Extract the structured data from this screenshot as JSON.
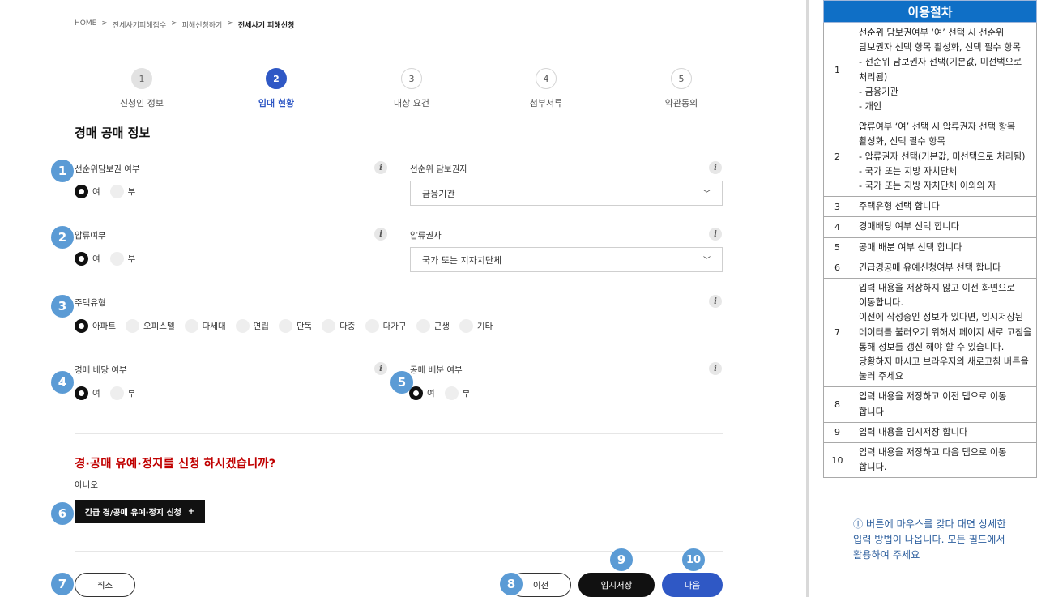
{
  "breadcrumb": [
    "HOME",
    "전세사기피해접수",
    "피해신청하기",
    "전세사기 피해신청"
  ],
  "breadcrumb_separator": ">",
  "steps": [
    {
      "num": "1",
      "label": "신청인 정보",
      "state": "done"
    },
    {
      "num": "2",
      "label": "임대 현황",
      "state": "active"
    },
    {
      "num": "3",
      "label": "대상 요건",
      "state": "todo"
    },
    {
      "num": "4",
      "label": "첨부서류",
      "state": "todo"
    },
    {
      "num": "5",
      "label": "약관동의",
      "state": "todo"
    }
  ],
  "section_title": "경매 공매 정보",
  "info_icon": "i",
  "fields": {
    "senior_collateral": {
      "label": "선순위담보권 여부",
      "options": [
        "여",
        "부"
      ],
      "selected": "여"
    },
    "senior_creditor": {
      "label": "선순위 담보권자",
      "value": "금융기관"
    },
    "seizure": {
      "label": "압류여부",
      "options": [
        "여",
        "부"
      ],
      "selected": "여"
    },
    "seizure_holder": {
      "label": "압류권자",
      "value": "국가 또는 지자치단체"
    },
    "housing_type": {
      "label": "주택유형",
      "options": [
        "아파트",
        "오피스텔",
        "다세대",
        "연립",
        "단독",
        "다중",
        "다가구",
        "근생",
        "기타"
      ],
      "selected": "아파트"
    },
    "auction_dividend": {
      "label": "경매 배당 여부",
      "options": [
        "여",
        "부"
      ],
      "selected": "여"
    },
    "public_dividend": {
      "label": "공매 배분 여부",
      "options": [
        "여",
        "부"
      ],
      "selected": "여"
    }
  },
  "question": "경·공매 유예·정지를 신청 하시겠습니까?",
  "answer": "아니오",
  "urgent_button": {
    "label": "긴급 경/공매 유예·정지 신청",
    "icon": "+"
  },
  "buttons": {
    "cancel": "취소",
    "prev": "이전",
    "temp_save": "임시저장",
    "next": "다음"
  },
  "badges": [
    "1",
    "2",
    "3",
    "4",
    "5",
    "6",
    "7",
    "8",
    "9",
    "10"
  ],
  "colors": {
    "accent": "#2f58c5",
    "badge": "#5b9bd5",
    "question": "#c00000",
    "panel_header": "#0f6fc6",
    "note": "#2d5f9e"
  },
  "panel": {
    "title": "이용절차",
    "rows": [
      {
        "num": "1",
        "text": "선순위 담보권여부 ‘여’ 선택 시 선순위 담보권자 선택 항목 활성화, 선택 필수 항목\n- 선순위 담보권자 선택(기본값, 미선택으로 처리됨)\n- 금융기관\n- 개인"
      },
      {
        "num": "2",
        "text": "압류여부 ‘여’ 선택 시 압류권자 선택 항목 활성화, 선택 필수 항목\n- 압류권자 선택(기본값, 미선택으로 처리됨)\n- 국가 또는 지방 자치단체\n- 국가 또는 지방 자치단체 이외의 자"
      },
      {
        "num": "3",
        "text": "주택유형 선택 합니다"
      },
      {
        "num": "4",
        "text": "경매배당 여부 선택 합니다"
      },
      {
        "num": "5",
        "text": "공매 배분 여부 선택 합니다"
      },
      {
        "num": "6",
        "text": "긴급경공매 유예신청여부 선택 합니다"
      },
      {
        "num": "7",
        "text": "입력 내용을 저장하지 않고 이전 화면으로 이동합니다.\n이전에 작성중인 정보가 있다면, 임시저장된 데이터를 불러오기 위해서 페이지 새로 고침을 통해 정보를 갱신 해야 할 수 있습니다. 당황하지 마시고 브라우저의 새로고침 버튼을 눌러 주세요"
      },
      {
        "num": "8",
        "text": "입력 내용을 저장하고 이전 탭으로 이동 합니다"
      },
      {
        "num": "9",
        "text": "입력 내용을 임시저장 합니다"
      },
      {
        "num": "10",
        "text": "입력 내용을 저장하고 다음 탭으로 이동 합니다."
      }
    ],
    "note": "ⓘ 버튼에 마우스를 갖다 대면 상세한 입력 방법이 나옵니다. 모든 필드에서 활용하여 주세요"
  }
}
